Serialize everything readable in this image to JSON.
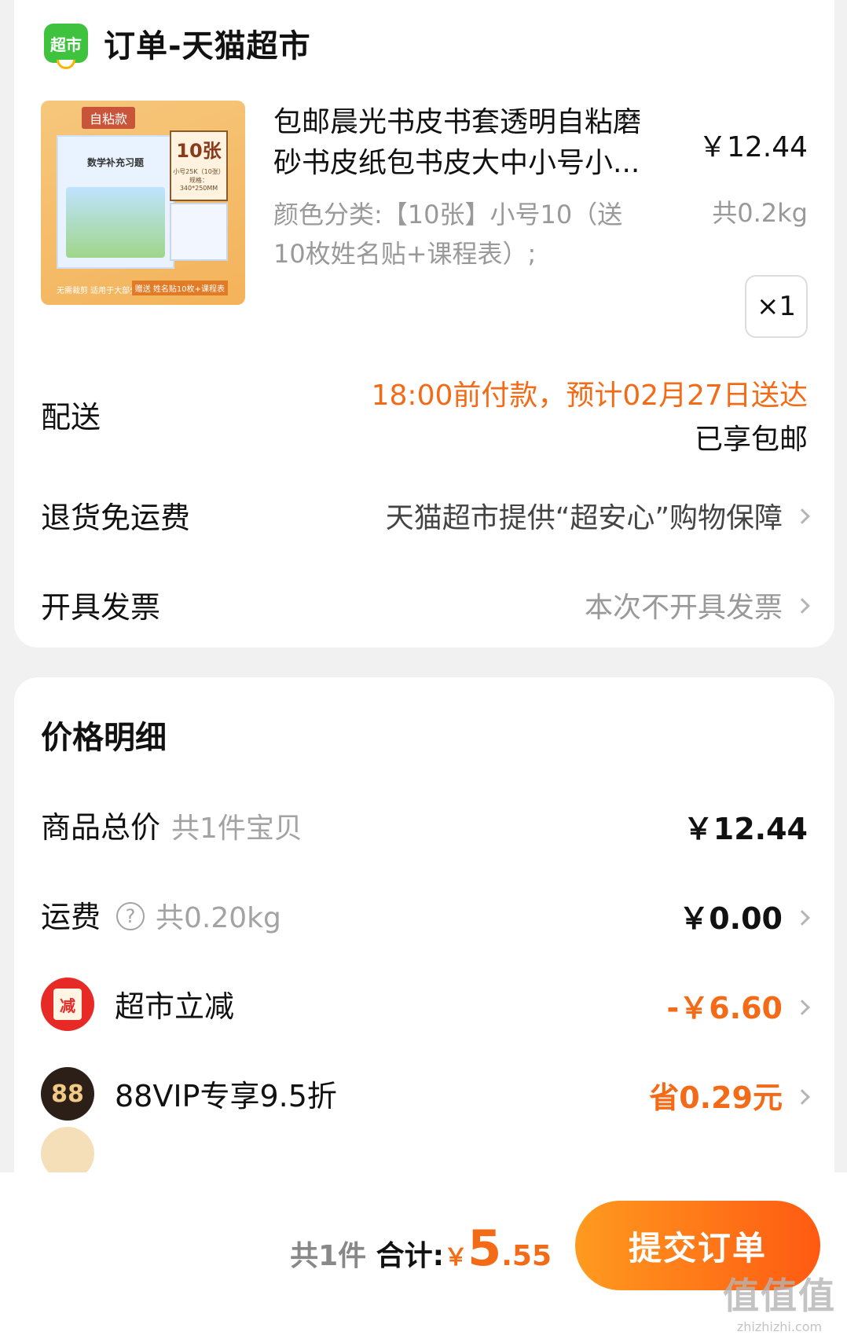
{
  "shop": {
    "logo_text": "超市",
    "title": "订单-天猫超市"
  },
  "product": {
    "thumb": {
      "tag": "自粘款",
      "book_title": "数学补充习题",
      "count": "10张",
      "count_sub": "小号25K（10张）规格：340*250MM",
      "foot": "无需裁剪 适用于大部分课本",
      "gift": "赠送 姓名贴10枚+课程表"
    },
    "title_line1": "包邮晨光书皮书套透明自粘磨",
    "title_line2": "砂书皮纸包书皮大中小号小...",
    "price": "￥12.44",
    "sku_line1": "颜色分类:【10张】小号10（送",
    "sku_line2": "10枚姓名贴+课程表）;",
    "weight": "共0.2kg",
    "qty": "×1"
  },
  "delivery": {
    "label": "配送",
    "line1": "18:00前付款，预计02月27日送达",
    "line2": "已享包邮"
  },
  "return_policy": {
    "label": "退货免运费",
    "value": "天猫超市提供“超安心”购物保障"
  },
  "invoice": {
    "label": "开具发票",
    "value": "本次不开具发票"
  },
  "price_detail": {
    "title": "价格明细",
    "goods_total": {
      "label": "商品总价",
      "sub": "共1件宝贝",
      "value": "￥12.44"
    },
    "shipping": {
      "label": "运费",
      "help": "?",
      "sub": "共0.20kg",
      "value": "￥0.00"
    },
    "discount": {
      "icon_text": "减",
      "label": "超市立减",
      "value": "-￥6.60"
    },
    "vip": {
      "icon_text": "88",
      "label": "88VIP专享9.5折",
      "value": "省0.29元"
    }
  },
  "footer": {
    "count": "共1件",
    "total_label": "合计:",
    "currency": "￥",
    "total_int": "5",
    "total_dec": ".55",
    "submit": "提交订单"
  },
  "watermark": {
    "main": "值值值",
    "sub": "zhizhizhi.com"
  }
}
